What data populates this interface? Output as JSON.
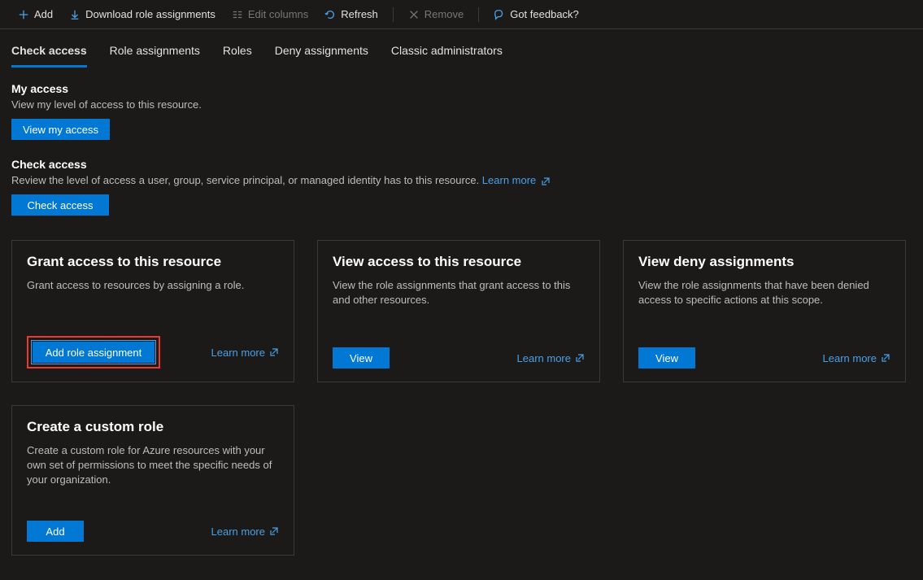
{
  "toolbar": {
    "add": "Add",
    "download": "Download role assignments",
    "edit_columns": "Edit columns",
    "refresh": "Refresh",
    "remove": "Remove",
    "feedback": "Got feedback?"
  },
  "tabs": {
    "check_access": "Check access",
    "role_assignments": "Role assignments",
    "roles": "Roles",
    "deny_assignments": "Deny assignments",
    "classic_admins": "Classic administrators"
  },
  "sections": {
    "my_access": {
      "title": "My access",
      "desc": "View my level of access to this resource.",
      "button": "View my access"
    },
    "check_access": {
      "title": "Check access",
      "desc": "Review the level of access a user, group, service principal, or managed identity has to this resource. ",
      "learn_more": "Learn more",
      "button": "Check access"
    }
  },
  "cards": {
    "grant": {
      "title": "Grant access to this resource",
      "desc": "Grant access to resources by assigning a role.",
      "button": "Add role assignment",
      "learn_more": "Learn more"
    },
    "view_access": {
      "title": "View access to this resource",
      "desc": "View the role assignments that grant access to this and other resources.",
      "button": "View",
      "learn_more": "Learn more"
    },
    "view_deny": {
      "title": "View deny assignments",
      "desc": "View the role assignments that have been denied access to specific actions at this scope.",
      "button": "View",
      "learn_more": "Learn more"
    },
    "custom_role": {
      "title": "Create a custom role",
      "desc": "Create a custom role for Azure resources with your own set of permissions to meet the specific needs of your organization.",
      "button": "Add",
      "learn_more": "Learn more"
    }
  }
}
